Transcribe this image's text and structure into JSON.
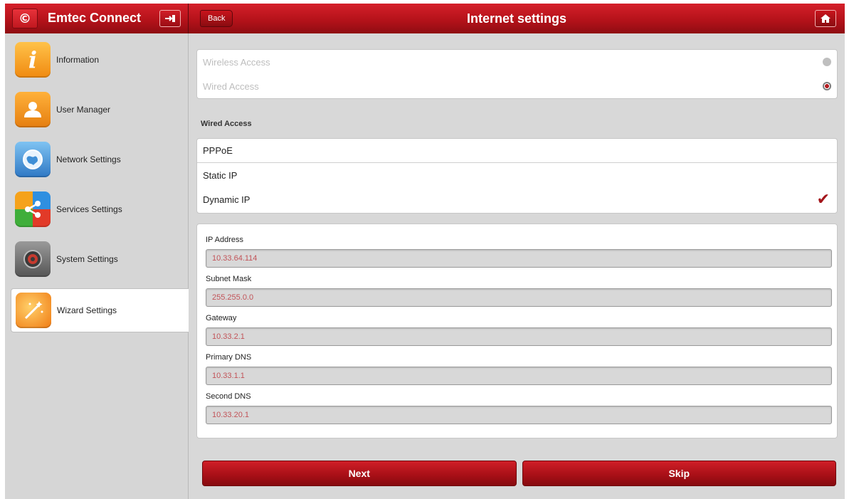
{
  "app": {
    "name": "Emtec Connect",
    "logo_glyph": "©"
  },
  "header": {
    "back_label": "Back",
    "title": "Internet settings"
  },
  "sidebar": {
    "items": [
      {
        "label": "Information",
        "icon": "info-icon",
        "color": "#f0a020"
      },
      {
        "label": "User Manager",
        "icon": "user-icon",
        "color": "#f29a18"
      },
      {
        "label": "Network Settings",
        "icon": "globe-icon",
        "color": "#3b8ed6"
      },
      {
        "label": "Services Settings",
        "icon": "share-icon",
        "color": "#e84a1f"
      },
      {
        "label": "System Settings",
        "icon": "gear-icon",
        "color": "#777777"
      },
      {
        "label": "Wizard Settings",
        "icon": "wand-icon",
        "color": "#f28a18",
        "active": true
      }
    ]
  },
  "access": {
    "options": [
      {
        "label": "Wireless Access",
        "selected": false
      },
      {
        "label": "Wired Access",
        "selected": true
      }
    ]
  },
  "wired": {
    "heading": "Wired Access",
    "modes": [
      {
        "label": "PPPoE",
        "selected": false
      },
      {
        "label": "Static IP",
        "selected": false
      },
      {
        "label": "Dynamic IP",
        "selected": true
      }
    ]
  },
  "ip": {
    "fields": [
      {
        "label": "IP Address",
        "value": "10.33.64.114"
      },
      {
        "label": "Subnet Mask",
        "value": "255.255.0.0"
      },
      {
        "label": "Gateway",
        "value": "10.33.2.1"
      },
      {
        "label": "Primary DNS",
        "value": "10.33.1.1"
      },
      {
        "label": "Second DNS",
        "value": "10.33.20.1"
      }
    ]
  },
  "actions": {
    "next_label": "Next",
    "skip_label": "Skip"
  },
  "colors": {
    "accent": "#b5121a",
    "value_text": "#c25358"
  }
}
